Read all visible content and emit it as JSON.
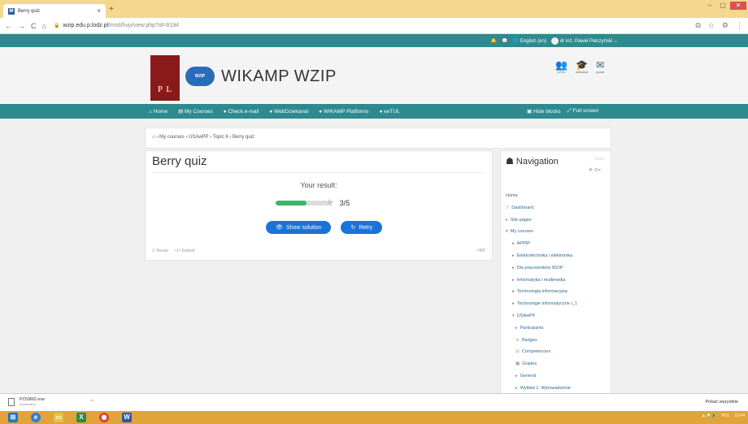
{
  "browser": {
    "tab_title": "Berry quiz",
    "tab_close": "×",
    "new_tab": "+",
    "url_host": "wzip.edu.p.lodz.pl",
    "url_path": "/mod/hvp/view.php?id=8194",
    "back": "←",
    "forward": "→",
    "reload": "C",
    "home": "⌂"
  },
  "topbar": {
    "language": "English (en)",
    "user_name": "dr inż. Paweł Pełczyński"
  },
  "header": {
    "logo_text": "P L",
    "gear_text": "WZIP",
    "site_name": "WIKAMP WZIP",
    "icons": [
      {
        "name": "users-icon",
        "label": "prTUL"
      },
      {
        "name": "graduation-cap-icon",
        "label": "dziekanat"
      },
      {
        "name": "envelope-icon",
        "label": "poczta"
      }
    ]
  },
  "navbar": {
    "items": [
      "Home",
      "My Courses",
      "Check e-mail",
      "WebDziekanat",
      "WIKAMP Platforms",
      "eeTUL"
    ],
    "hide_blocks": "Hide blocks",
    "full_screen": "Full screen"
  },
  "breadcrumb": "› My courses › USAwPP › Topic 6 › Berry quiz",
  "main": {
    "title": "Berry quiz",
    "result_label": "Your result:",
    "score": "3/5",
    "score_fraction": 0.6,
    "show_solution": "Show solution",
    "retry": "Retry",
    "reuse": "Reuse",
    "embed": "Embed",
    "h5p_brand": "H5P"
  },
  "navigation": {
    "title": "Navigation",
    "items": [
      {
        "label": "Home",
        "level": "home"
      },
      {
        "label": "Dashboard",
        "level": "lv1",
        "icon": "▽"
      },
      {
        "label": "Site pages",
        "level": "lv1",
        "icon": "▸"
      },
      {
        "label": "My courses",
        "level": "lv1",
        "icon": "▾"
      },
      {
        "label": "APPIP",
        "level": "lv2",
        "icon": "▸"
      },
      {
        "label": "Elektrotechnika i elektronika",
        "level": "lv2",
        "icon": "▸"
      },
      {
        "label": "Dla pracowników WZIP",
        "level": "lv2",
        "icon": "▸"
      },
      {
        "label": "Informatyka i multimedia",
        "level": "lv2",
        "icon": "▸"
      },
      {
        "label": "Technologia informacyjna",
        "level": "lv2",
        "icon": "▸"
      },
      {
        "label": "Technologie informatyczne I_1",
        "level": "lv2",
        "icon": "▸"
      },
      {
        "label": "USAwPP",
        "level": "lv2",
        "icon": "▾"
      },
      {
        "label": "Participants",
        "level": "lv3",
        "icon": "▸"
      },
      {
        "label": "Badges",
        "level": "lv3",
        "icon": "♕"
      },
      {
        "label": "Competencies",
        "level": "lv3",
        "icon": "⚖"
      },
      {
        "label": "Grades",
        "level": "lv3",
        "icon": "▦"
      },
      {
        "label": "General",
        "level": "lv3",
        "icon": "▸"
      },
      {
        "label": "Wykład 1. Wprowadzenie",
        "level": "lv3",
        "icon": "▸"
      }
    ]
  },
  "download": {
    "file": "POSIM2.exe",
    "status": "Anulowano",
    "show_all": "Pokaż wszystkie"
  },
  "taskbar": {
    "lang": "POL",
    "time": "12:44"
  }
}
